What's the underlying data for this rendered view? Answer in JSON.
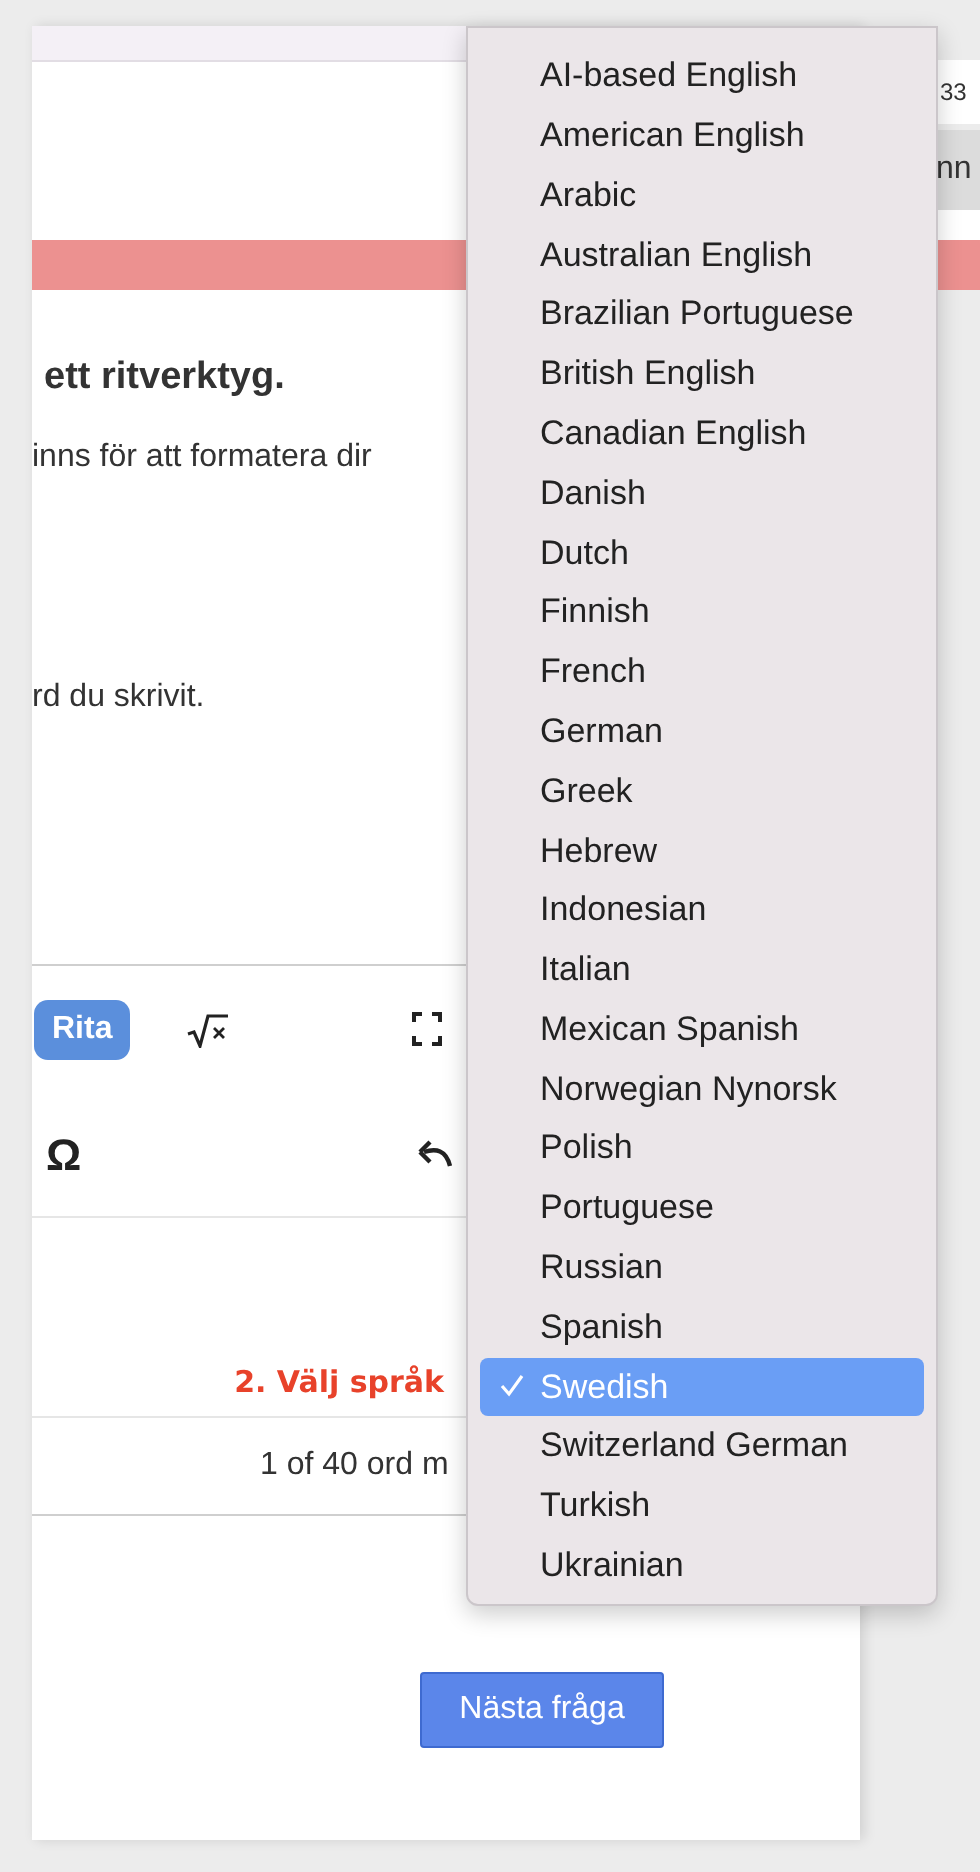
{
  "question": {
    "heading": "ett ritverktyg.",
    "lines": [
      "inns för att formatera dir",
      "rd du skrivit."
    ]
  },
  "toolbar": {
    "draw_button": "Rita",
    "symbol": "Ω"
  },
  "language_hint": "2. Välj språk",
  "word_count": "1 of 40 ord m",
  "next_button": "Nästa fråga",
  "side": {
    "field_value": "33",
    "cell": "nn"
  },
  "language_menu": [
    {
      "label": "AI-based English",
      "selected": false
    },
    {
      "label": "American English",
      "selected": false
    },
    {
      "label": "Arabic",
      "selected": false
    },
    {
      "label": "Australian English",
      "selected": false
    },
    {
      "label": "Brazilian Portuguese",
      "selected": false
    },
    {
      "label": "British English",
      "selected": false
    },
    {
      "label": "Canadian English",
      "selected": false
    },
    {
      "label": "Danish",
      "selected": false
    },
    {
      "label": "Dutch",
      "selected": false
    },
    {
      "label": "Finnish",
      "selected": false
    },
    {
      "label": "French",
      "selected": false
    },
    {
      "label": "German",
      "selected": false
    },
    {
      "label": "Greek",
      "selected": false
    },
    {
      "label": "Hebrew",
      "selected": false
    },
    {
      "label": "Indonesian",
      "selected": false
    },
    {
      "label": "Italian",
      "selected": false
    },
    {
      "label": "Mexican Spanish",
      "selected": false
    },
    {
      "label": "Norwegian Nynorsk",
      "selected": false
    },
    {
      "label": "Polish",
      "selected": false
    },
    {
      "label": "Portuguese",
      "selected": false
    },
    {
      "label": "Russian",
      "selected": false
    },
    {
      "label": "Spanish",
      "selected": false
    },
    {
      "label": "Swedish",
      "selected": true
    },
    {
      "label": "Switzerland German",
      "selected": false
    },
    {
      "label": "Turkish",
      "selected": false
    },
    {
      "label": "Ukrainian",
      "selected": false
    }
  ]
}
